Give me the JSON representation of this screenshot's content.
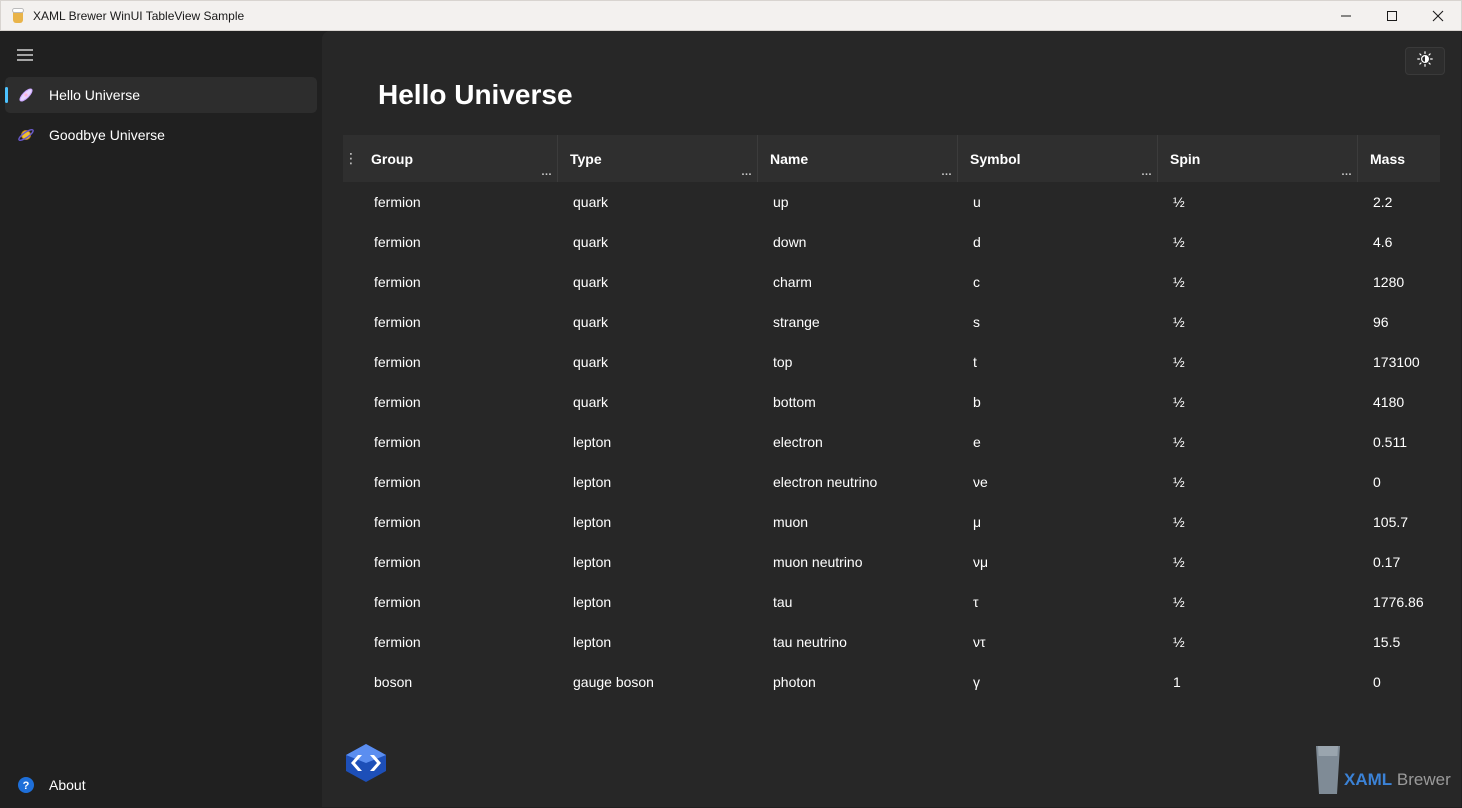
{
  "window": {
    "title": "XAML Brewer WinUI TableView Sample",
    "controls": [
      "minimize-icon",
      "maximize-icon",
      "close-icon"
    ]
  },
  "sidebar": {
    "items": [
      {
        "label": "Hello Universe",
        "icon": "galaxy-icon",
        "selected": true
      },
      {
        "label": "Goodbye Universe",
        "icon": "planet-icon",
        "selected": false
      }
    ],
    "footer": {
      "label": "About",
      "icon": "help-icon"
    }
  },
  "page": {
    "title": "Hello Universe",
    "theme_toggle_icon": "brightness-icon"
  },
  "table": {
    "columns": [
      "Group",
      "Type",
      "Name",
      "Symbol",
      "Spin",
      "Mass"
    ],
    "rows": [
      [
        "fermion",
        "quark",
        "up",
        "u",
        "½",
        "2.2"
      ],
      [
        "fermion",
        "quark",
        "down",
        "d",
        "½",
        "4.6"
      ],
      [
        "fermion",
        "quark",
        "charm",
        "c",
        "½",
        "1280"
      ],
      [
        "fermion",
        "quark",
        "strange",
        "s",
        "½",
        "96"
      ],
      [
        "fermion",
        "quark",
        "top",
        "t",
        "½",
        "173100"
      ],
      [
        "fermion",
        "quark",
        "bottom",
        "b",
        "½",
        "4180"
      ],
      [
        "fermion",
        "lepton",
        "electron",
        "e",
        "½",
        "0.511"
      ],
      [
        "fermion",
        "lepton",
        "electron neutrino",
        "νe",
        "½",
        "0"
      ],
      [
        "fermion",
        "lepton",
        "muon",
        "μ",
        "½",
        "105.7"
      ],
      [
        "fermion",
        "lepton",
        "muon neutrino",
        "νμ",
        "½",
        "0.17"
      ],
      [
        "fermion",
        "lepton",
        "tau",
        "τ",
        "½",
        "1776.86"
      ],
      [
        "fermion",
        "lepton",
        "tau neutrino",
        "ντ",
        "½",
        "15.5"
      ],
      [
        "boson",
        "gauge boson",
        "photon",
        "γ",
        "1",
        "0"
      ]
    ]
  },
  "branding": {
    "brand_x": "XAML",
    "brand_b": "Brewer"
  },
  "colors": {
    "accent": "#4cc2ff",
    "brand_blue": "#3b82d6"
  }
}
